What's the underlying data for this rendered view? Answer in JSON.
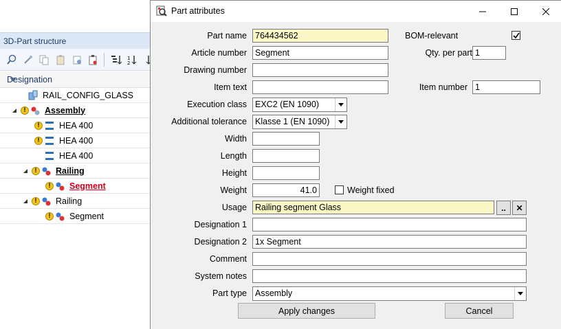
{
  "structure": {
    "title": "3D-Part structure",
    "header_label": "Designation",
    "rows": [
      {
        "label": "RAIL_CONFIG_GLASS"
      },
      {
        "label": "Assembly"
      },
      {
        "label": "HEA 400"
      },
      {
        "label": "HEA 400"
      },
      {
        "label": "HEA 400"
      },
      {
        "label": "Railing"
      },
      {
        "label": "Segment"
      },
      {
        "label": "Railing"
      },
      {
        "label": "Segment"
      }
    ]
  },
  "dialog": {
    "title": "Part attributes",
    "fields": {
      "part_name": {
        "label": "Part name",
        "value": "764434562"
      },
      "article_number": {
        "label": "Article number",
        "value": "Segment"
      },
      "drawing_number": {
        "label": "Drawing number",
        "value": ""
      },
      "item_text": {
        "label": "Item text",
        "value": ""
      },
      "execution_class": {
        "label": "Execution class",
        "value": "EXC2 (EN 1090)"
      },
      "additional_tolerance": {
        "label": "Additional tolerance",
        "value": "Klasse 1 (EN 1090)"
      },
      "width": {
        "label": "Width",
        "value": ""
      },
      "length": {
        "label": "Length",
        "value": ""
      },
      "height": {
        "label": "Height",
        "value": ""
      },
      "weight": {
        "label": "Weight",
        "value": "41.0"
      },
      "weight_fixed": {
        "label": "Weight fixed",
        "checked": false
      },
      "usage": {
        "label": "Usage",
        "value": "Railing segment Glass"
      },
      "designation_1": {
        "label": "Designation 1",
        "value": ""
      },
      "designation_2": {
        "label": "Designation 2",
        "value": "1x Segment"
      },
      "comment": {
        "label": "Comment",
        "value": ""
      },
      "system_notes": {
        "label": "System notes",
        "value": ""
      },
      "part_type": {
        "label": "Part type",
        "value": "Assembly"
      },
      "bom_relevant": {
        "label": "BOM-relevant",
        "checked": true
      },
      "qty_per_part": {
        "label": "Qty. per part",
        "value": "1"
      },
      "item_number": {
        "label": "Item number",
        "value": "1"
      }
    },
    "usage_browse_label": "..",
    "usage_clear_label": "✕",
    "apply_label": "Apply changes",
    "cancel_label": "Cancel"
  },
  "colors": {
    "highlight_field": "#fbf7c6",
    "panel_title_bg": "#dce8f6",
    "accent_red": "#d2001a"
  }
}
